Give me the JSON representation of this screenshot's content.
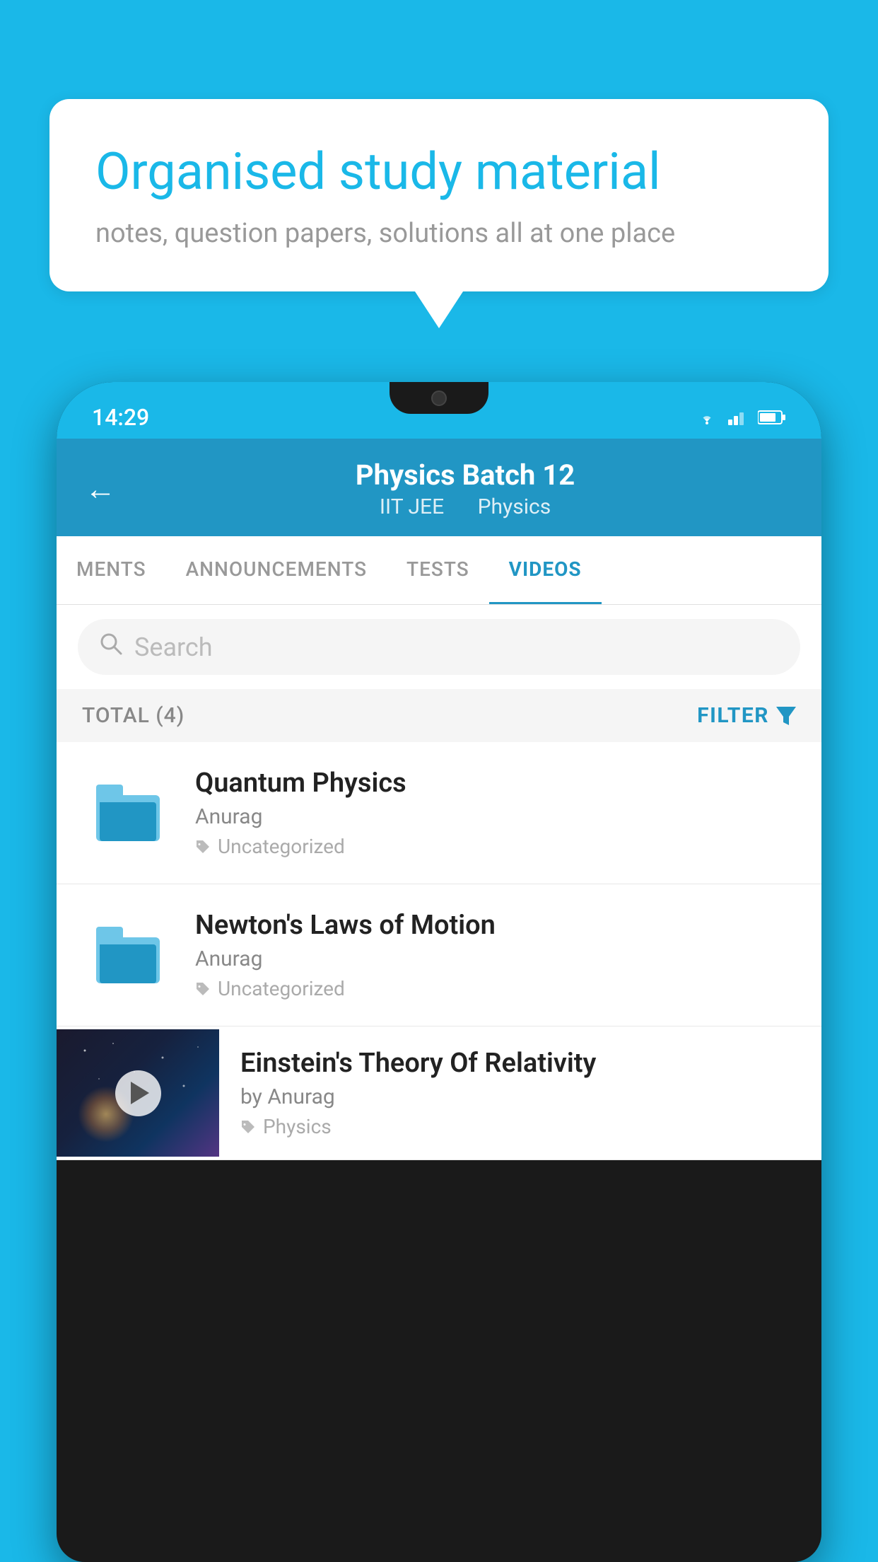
{
  "background": {
    "color": "#1ab8e8"
  },
  "speech_bubble": {
    "title": "Organised study material",
    "subtitle": "notes, question papers, solutions all at one place"
  },
  "phone": {
    "status_bar": {
      "time": "14:29"
    },
    "header": {
      "title": "Physics Batch 12",
      "subtitle_part1": "IIT JEE",
      "subtitle_part2": "Physics",
      "back_label": "←"
    },
    "tabs": [
      {
        "label": "MENTS",
        "active": false
      },
      {
        "label": "ANNOUNCEMENTS",
        "active": false
      },
      {
        "label": "TESTS",
        "active": false
      },
      {
        "label": "VIDEOS",
        "active": true
      }
    ],
    "search": {
      "placeholder": "Search"
    },
    "filter_row": {
      "total_label": "TOTAL (4)",
      "filter_label": "FILTER"
    },
    "videos": [
      {
        "title": "Quantum Physics",
        "author": "Anurag",
        "tag": "Uncategorized",
        "has_thumbnail": false
      },
      {
        "title": "Newton's Laws of Motion",
        "author": "Anurag",
        "tag": "Uncategorized",
        "has_thumbnail": false
      },
      {
        "title": "Einstein's Theory Of Relativity",
        "author": "by Anurag",
        "tag": "Physics",
        "has_thumbnail": true
      }
    ]
  }
}
